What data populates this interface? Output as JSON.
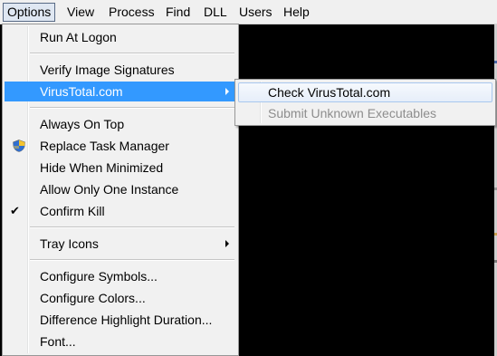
{
  "menubar": {
    "items": [
      "Options",
      "View",
      "Process",
      "Find",
      "DLL",
      "Users",
      "Help"
    ],
    "active_index": 0
  },
  "options_menu": {
    "run_at_logon": "Run At Logon",
    "verify_image_signatures": "Verify Image Signatures",
    "virustotal": "VirusTotal.com",
    "always_on_top": "Always On Top",
    "replace_task_manager": "Replace Task Manager",
    "hide_when_minimized": "Hide When Minimized",
    "allow_only_one_instance": "Allow Only One Instance",
    "confirm_kill": "Confirm Kill",
    "confirm_kill_checked": true,
    "tray_icons": "Tray Icons",
    "configure_symbols": "Configure Symbols...",
    "configure_colors": "Configure Colors...",
    "difference_highlight_duration": "Difference Highlight Duration...",
    "font": "Font..."
  },
  "virustotal_submenu": {
    "check_virustotal": "Check VirusTotal.com",
    "submit_unknown_executables": "Submit Unknown Executables",
    "submit_enabled": false
  },
  "colors": {
    "menu_background": "#f1f1f1",
    "highlight": "#3399ff",
    "hover_border": "#a8c7ee",
    "disabled_text": "#8d8d8d",
    "backdrop": "#000000"
  },
  "icons": {
    "confirm_kill": "checkmark-icon",
    "replace_task_manager": "uac-shield-icon",
    "submenu_indicator": "chevron-right-icon"
  }
}
